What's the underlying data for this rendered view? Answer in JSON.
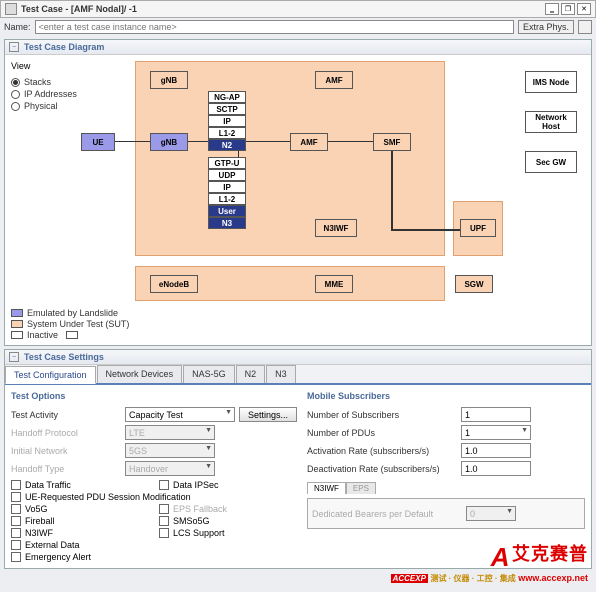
{
  "window": {
    "title": "Test Case - [AMF Nodal]/ -1"
  },
  "name_bar": {
    "label": "Name:",
    "placeholder": "<enter a test case instance name>",
    "extra_phys": "Extra Phys."
  },
  "diagram": {
    "title": "Test Case Diagram",
    "view_label": "View",
    "view_options": {
      "stacks": "Stacks",
      "ip": "IP Addresses",
      "physical": "Physical"
    },
    "nodes": {
      "gnb_top": "gNB",
      "amf_top": "AMF",
      "ims": "IMS Node",
      "nethost": "Network\nHost",
      "secgw": "Sec GW",
      "ue": "UE",
      "gnb": "gNB",
      "amf": "AMF",
      "smf": "SMF",
      "n3iwf": "N3IWF",
      "upf": "UPF",
      "enodeb": "eNodeB",
      "mme": "MME",
      "sgw": "SGW",
      "n2": "N2",
      "n3": "N3",
      "stack1": [
        "NG-AP",
        "SCTP",
        "IP",
        "L1-2"
      ],
      "stack2": [
        "GTP-U",
        "UDP",
        "IP",
        "L1-2",
        "User"
      ]
    },
    "legend": {
      "l1": "Emulated by Landslide",
      "l2": "System Under Test (SUT)",
      "l3": "Inactive"
    }
  },
  "settings": {
    "title": "Test Case Settings",
    "tabs": [
      "Test Configuration",
      "Network Devices",
      "NAS-5G",
      "N2",
      "N3"
    ],
    "test_options": {
      "title": "Test Options",
      "activity_label": "Test Activity",
      "activity_value": "Capacity Test",
      "settings_btn": "Settings...",
      "handoff_proto": "Handoff Protocol",
      "handoff_proto_val": "LTE",
      "initial_net": "Initial Network",
      "initial_net_val": "5GS",
      "handoff_type": "Handoff Type",
      "handoff_type_val": "Handover",
      "checks": {
        "data_traffic": "Data Traffic",
        "data_ipsec": "Data IPSec",
        "ue_req": "UE-Requested PDU Session Modification",
        "vo5g": "Vo5G",
        "eps_fb": "EPS Fallback",
        "fireball": "Fireball",
        "smso5g": "SMSo5G",
        "n3iwf": "N3IWF",
        "lcs": "LCS Support",
        "ext_data": "External Data",
        "emerg": "Emergency Alert"
      }
    },
    "mobile_subs": {
      "title": "Mobile Subscribers",
      "num_subs": "Number of Subscribers",
      "num_subs_val": "1",
      "num_pdus": "Number of PDUs",
      "num_pdus_val": "1",
      "act_rate": "Activation Rate (subscribers/s)",
      "act_rate_val": "1.0",
      "deact_rate": "Deactivation Rate (subscribers/s)",
      "deact_rate_val": "1.0",
      "sub_tabs": [
        "N3IWF",
        "EPS"
      ],
      "ded_bearers": "Dedicated Bearers per Default",
      "ded_bearers_val": "0"
    }
  },
  "watermark": {
    "cn": "艾克赛普",
    "sub": "测试 · 仪器 · 工控 · 集成",
    "url": "www.accexp.net",
    "brand": "ACCEXP"
  }
}
